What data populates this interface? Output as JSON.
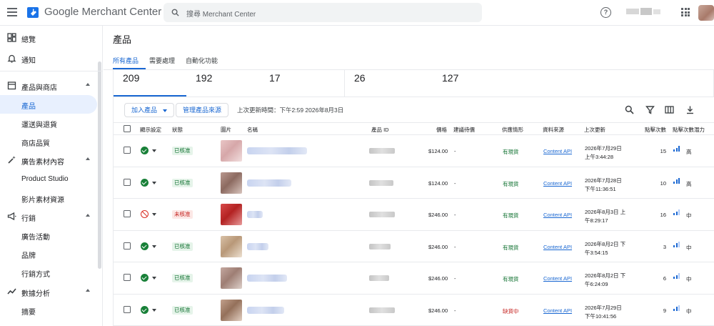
{
  "header": {
    "app_name": "Google Merchant Center",
    "search_placeholder": "搜尋 Merchant Center"
  },
  "sidebar": {
    "items": [
      {
        "label": "總覽",
        "icon": "dashboard-icon"
      },
      {
        "label": "通知",
        "icon": "bell-icon"
      },
      {
        "label": "產品與商店",
        "icon": "store-icon"
      },
      {
        "label": "產品",
        "icon": ""
      },
      {
        "label": "運送與退貨",
        "icon": ""
      },
      {
        "label": "商店品質",
        "icon": ""
      },
      {
        "label": "廣告素材內容",
        "icon": "magic-wand-icon"
      },
      {
        "label": "Product Studio",
        "icon": ""
      },
      {
        "label": "影片素材資源",
        "icon": ""
      },
      {
        "label": "行銷",
        "icon": "megaphone-icon"
      },
      {
        "label": "廣告活動",
        "icon": ""
      },
      {
        "label": "品牌",
        "icon": ""
      },
      {
        "label": "行銷方式",
        "icon": ""
      },
      {
        "label": "數據分析",
        "icon": "analytics-icon"
      },
      {
        "label": "摘要",
        "icon": ""
      }
    ]
  },
  "page": {
    "title": "產品",
    "tabs": [
      "所有產品",
      "需要處理",
      "自動化功能"
    ]
  },
  "counts": [
    "209",
    "192",
    "17",
    "26",
    "127"
  ],
  "toolbar": {
    "add_product": "加入產品",
    "manage_sources": "管理產品來源",
    "last_updated": "上次更新時間：下午2:59 2026年8月3日"
  },
  "table": {
    "headers": [
      "顯示設定",
      "狀態",
      "圖片",
      "名稱",
      "產品 ID",
      "價格",
      "建議待價",
      "供應情形",
      "資料來源",
      "上次更新",
      "點擊次數",
      "點擊次數潛力"
    ],
    "rows": [
      {
        "visible": true,
        "status": "已核准",
        "status_ok": true,
        "price": "$124.00",
        "suggested": "-",
        "availability": "有現貨",
        "in_stock": true,
        "source": "Content API",
        "updated_1": "2026年7月29日",
        "updated_2": "上午3:44:28",
        "clicks": "15",
        "potential": "高",
        "thumb_colors": [
          "#e9c6c6",
          "#d6a7a9",
          "#f1dede"
        ]
      },
      {
        "visible": true,
        "status": "已核准",
        "status_ok": true,
        "price": "$124.00",
        "suggested": "-",
        "availability": "有現貨",
        "in_stock": true,
        "source": "Content API",
        "updated_1": "2026年7月28日",
        "updated_2": "下午11:36:51",
        "clicks": "10",
        "potential": "高",
        "thumb_colors": [
          "#b9988f",
          "#8c6a60",
          "#d8c4bd"
        ]
      },
      {
        "visible": false,
        "status": "未核准",
        "status_ok": false,
        "price": "$246.00",
        "suggested": "-",
        "availability": "有現貨",
        "in_stock": true,
        "source": "Content API",
        "updated_1": "2026年8月3日 上",
        "updated_2": "午8:29:17",
        "clicks": "16",
        "potential": "中",
        "thumb_colors": [
          "#d84a4a",
          "#b32222",
          "#e89a9a"
        ]
      },
      {
        "visible": true,
        "status": "已核准",
        "status_ok": true,
        "price": "$246.00",
        "suggested": "-",
        "availability": "有現貨",
        "in_stock": true,
        "source": "Content API",
        "updated_1": "2026年8月2日 下",
        "updated_2": "午3:54:15",
        "clicks": "3",
        "potential": "中",
        "thumb_colors": [
          "#d9c2a8",
          "#b89878",
          "#ede0d0"
        ]
      },
      {
        "visible": true,
        "status": "已核准",
        "status_ok": true,
        "price": "$246.00",
        "suggested": "-",
        "availability": "有現貨",
        "in_stock": true,
        "source": "Content API",
        "updated_1": "2026年8月2日 下",
        "updated_2": "午6:24:09",
        "clicks": "6",
        "potential": "中",
        "thumb_colors": [
          "#c4a8a0",
          "#9e7e74",
          "#ddd0ca"
        ]
      },
      {
        "visible": true,
        "status": "已核准",
        "status_ok": true,
        "price": "$246.00",
        "suggested": "-",
        "availability": "缺貨中",
        "in_stock": false,
        "source": "Content API",
        "updated_1": "2026年7月29日",
        "updated_2": "下午10:41:56",
        "clicks": "9",
        "potential": "中",
        "thumb_colors": [
          "#c2a08c",
          "#94705a",
          "#e2cfc2"
        ]
      }
    ]
  },
  "colors": {
    "accent": "#1967d2",
    "approved_bg": "#e6f4ea",
    "approved_text": "#137333",
    "rejected_bg": "#fce8e6",
    "rejected_text": "#c5221f"
  }
}
